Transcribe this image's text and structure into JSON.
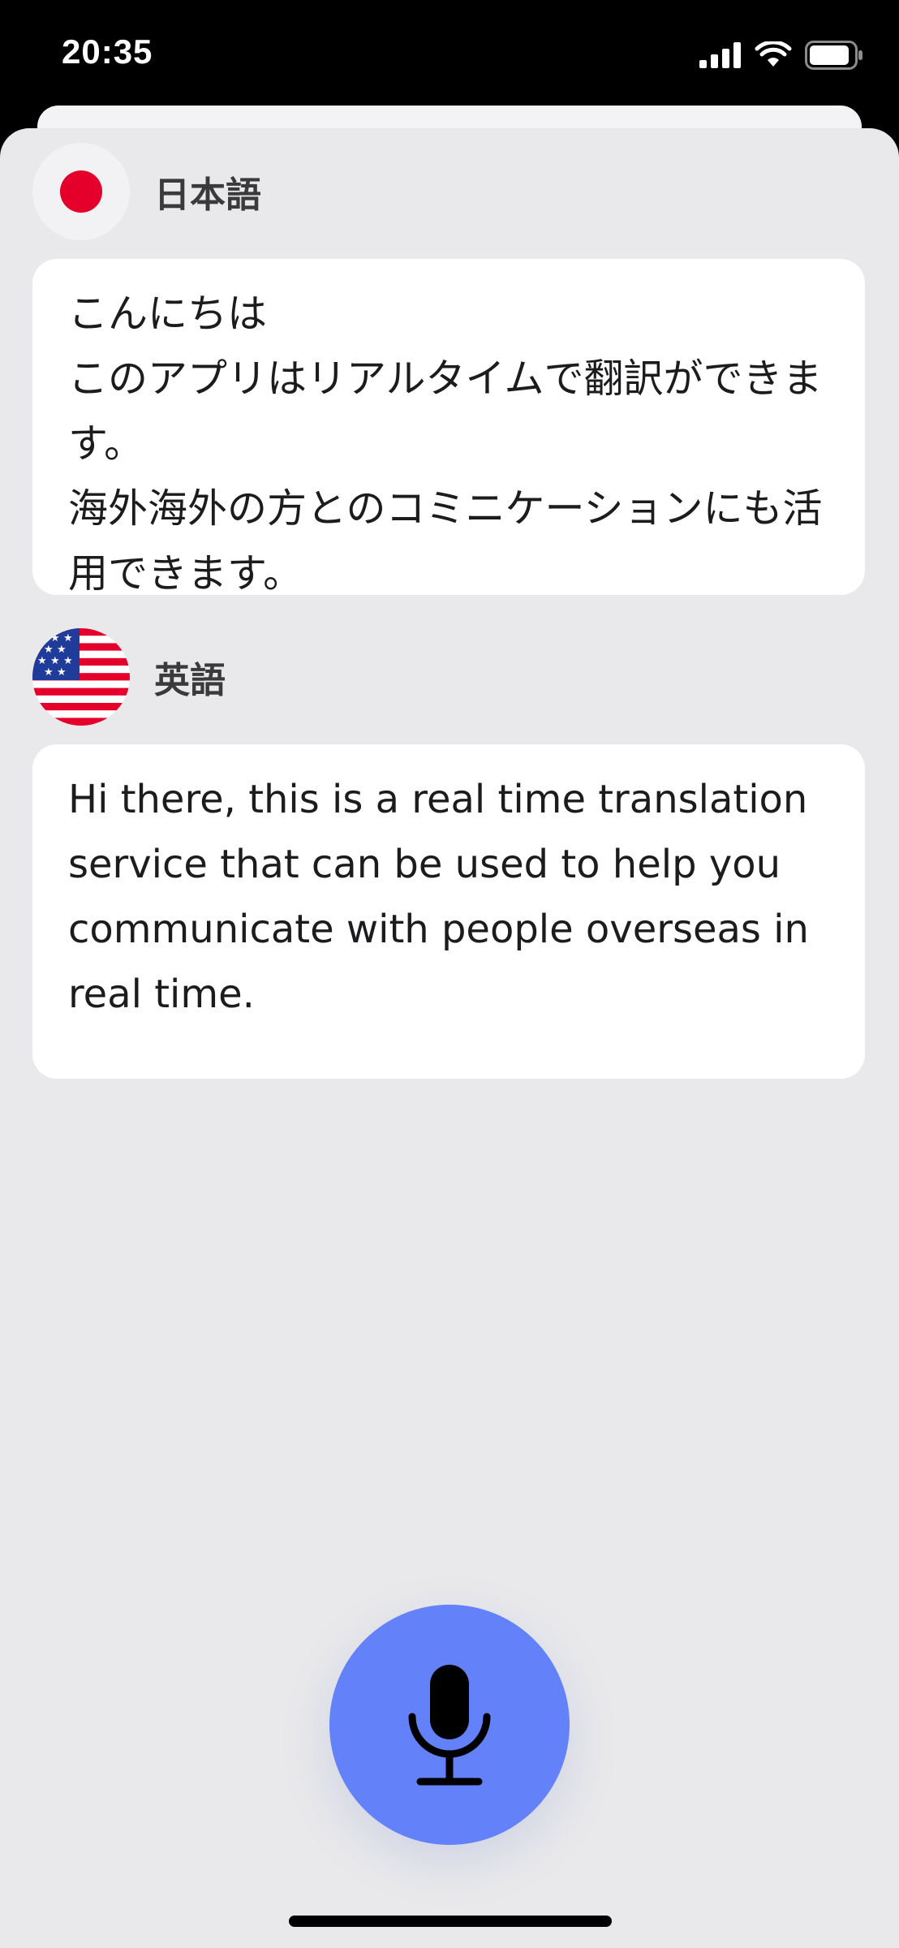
{
  "status_bar": {
    "time": "20:35",
    "icons": [
      "signal-icon",
      "wifi-icon",
      "battery-icon"
    ]
  },
  "source": {
    "flag": "japan-flag-icon",
    "language": "日本語",
    "text": "こんにちは\nこのアプリはリアルタイムで翻訳ができます。\n海外海外の方とのコミニケーションにも活用できます。"
  },
  "target": {
    "flag": "usa-flag-icon",
    "language": "英語",
    "text": "Hi there, this is a real time translation service that can be used to help you communicate with people overseas in real time."
  },
  "mic": {
    "icon": "microphone-icon"
  },
  "colors": {
    "background": "#e9e9eb",
    "card": "#ffffff",
    "mic_button": "#6381f9",
    "japan_red": "#e4002b"
  }
}
